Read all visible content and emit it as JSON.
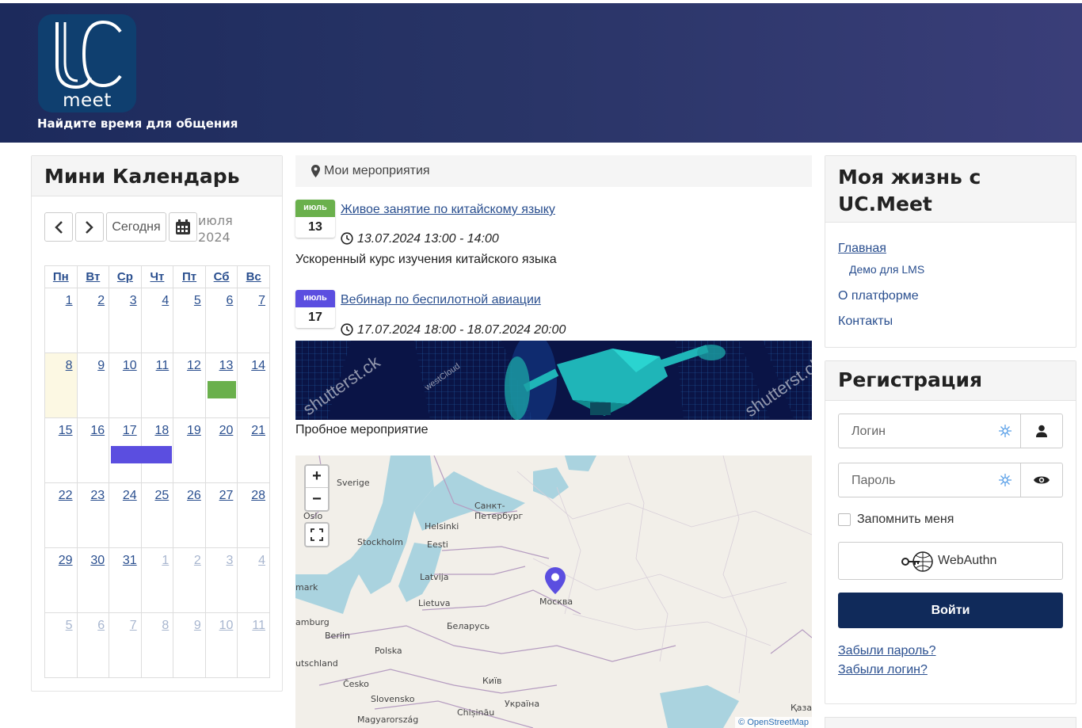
{
  "header": {
    "logo_text": "meet",
    "tagline": "Найдите время для общения",
    "colors": {
      "brand_dark": "#1c2a5c",
      "logo_bg": "#0f3f6f"
    }
  },
  "calendar": {
    "title": "Мини Календарь",
    "today_label": "Сегодня",
    "month_label": "июля",
    "year_label": "2024",
    "weekdays": [
      "Пн",
      "Вт",
      "Ср",
      "Чт",
      "Пт",
      "Сб",
      "Вс"
    ],
    "weeks": [
      [
        "1",
        "2",
        "3",
        "4",
        "5",
        "6",
        "7"
      ],
      [
        "8",
        "9",
        "10",
        "11",
        "12",
        "13",
        "14"
      ],
      [
        "15",
        "16",
        "17",
        "18",
        "19",
        "20",
        "21"
      ],
      [
        "22",
        "23",
        "24",
        "25",
        "26",
        "27",
        "28"
      ],
      [
        "29",
        "30",
        "31",
        "1",
        "2",
        "3",
        "4"
      ],
      [
        "5",
        "6",
        "7",
        "8",
        "9",
        "10",
        "11"
      ]
    ],
    "event_colors": {
      "green": "#6ab04c",
      "purple": "#5b4ee0"
    }
  },
  "events": {
    "title": "Мои мероприятия",
    "items": [
      {
        "month": "июль",
        "day": "13",
        "title": "Живое занятие по китайскому языку",
        "time": "13.07.2024 13:00 - 14:00",
        "description": "Ускоренный курс изучения китайского языка",
        "color": "#6ab04c"
      },
      {
        "month": "июль",
        "day": "17",
        "title": "Вебинар по беспилотной авиации",
        "time": "17.07.2024 18:00 - 18.07.2024 20:00",
        "description": "Пробное мероприятие",
        "color": "#5b4ee0"
      }
    ],
    "banner_watermarks": [
      "shutterst.ck",
      "westCloud",
      "shutterst.ck"
    ]
  },
  "map": {
    "labels": [
      "Sverige",
      "Санкт-Петербург",
      "Oslo",
      "Helsinki",
      "Stockholm",
      "Eesti",
      "Latvija",
      "Москва",
      "mark",
      "Lietuva",
      "amburg",
      "Беларусь",
      "Berlin",
      "Polska",
      "utschland",
      "Česko",
      "Київ",
      "Slovensko",
      "Україна",
      "Chișinău",
      "Magyarország",
      "Қаза"
    ],
    "zoom_in": "+",
    "zoom_out": "−",
    "attribution": "© OpenStreetMap"
  },
  "life": {
    "title": "Моя жизнь с UC.Meet",
    "links": [
      "Главная",
      "Демо для LMS",
      "О платформе",
      "Контакты"
    ]
  },
  "registration": {
    "title": "Регистрация",
    "login_placeholder": "Логин",
    "password_placeholder": "Пароль",
    "remember_label": "Запомнить меня",
    "webauthn_label": "WebAuthn",
    "login_button": "Войти",
    "forgot_password": "Забыли пароль?",
    "forgot_login": "Забыли логин?"
  }
}
